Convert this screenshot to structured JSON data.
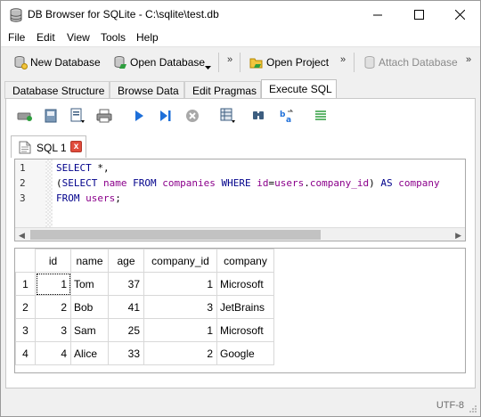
{
  "window": {
    "title": "DB Browser for SQLite - C:\\sqlite\\test.db"
  },
  "menu": [
    "File",
    "Edit",
    "View",
    "Tools",
    "Help"
  ],
  "toolbar": {
    "new_db": "New Database",
    "open_db": "Open Database",
    "more": "»",
    "open_project": "Open Project",
    "attach_db": "Attach Database"
  },
  "tabs": [
    "Database Structure",
    "Browse Data",
    "Edit Pragmas",
    "Execute SQL"
  ],
  "sql_tab": {
    "label": "SQL 1",
    "close": "x"
  },
  "editor": {
    "line_numbers": [
      "1",
      "2",
      "3"
    ],
    "lines": [
      [
        {
          "t": "SELECT",
          "c": "kw"
        },
        {
          "t": " *,",
          "c": ""
        }
      ],
      [
        {
          "t": "(",
          "c": ""
        },
        {
          "t": "SELECT",
          "c": "kw"
        },
        {
          "t": " ",
          "c": ""
        },
        {
          "t": "name",
          "c": "idt"
        },
        {
          "t": " ",
          "c": ""
        },
        {
          "t": "FROM",
          "c": "kw"
        },
        {
          "t": " ",
          "c": ""
        },
        {
          "t": "companies",
          "c": "idt"
        },
        {
          "t": " ",
          "c": ""
        },
        {
          "t": "WHERE",
          "c": "kw"
        },
        {
          "t": " ",
          "c": ""
        },
        {
          "t": "id",
          "c": "idt"
        },
        {
          "t": "=",
          "c": ""
        },
        {
          "t": "users",
          "c": "idt"
        },
        {
          "t": ".",
          "c": ""
        },
        {
          "t": "company_id",
          "c": "idt"
        },
        {
          "t": ") ",
          "c": ""
        },
        {
          "t": "AS",
          "c": "kw"
        },
        {
          "t": " ",
          "c": ""
        },
        {
          "t": "company",
          "c": "idt"
        }
      ],
      [
        {
          "t": "FROM",
          "c": "kw"
        },
        {
          "t": " ",
          "c": ""
        },
        {
          "t": "users",
          "c": "idt"
        },
        {
          "t": ";",
          "c": ""
        }
      ]
    ]
  },
  "results": {
    "columns": [
      "id",
      "name",
      "age",
      "company_id",
      "company"
    ],
    "rows": [
      {
        "rownum": "1",
        "id": "1",
        "name": "Tom",
        "age": "37",
        "company_id": "1",
        "company": "Microsoft"
      },
      {
        "rownum": "2",
        "id": "2",
        "name": "Bob",
        "age": "41",
        "company_id": "3",
        "company": "JetBrains"
      },
      {
        "rownum": "3",
        "id": "3",
        "name": "Sam",
        "age": "25",
        "company_id": "1",
        "company": "Microsoft"
      },
      {
        "rownum": "4",
        "id": "4",
        "name": "Alice",
        "age": "33",
        "company_id": "2",
        "company": "Google"
      }
    ]
  },
  "status": {
    "encoding": "UTF-8"
  },
  "colors": {
    "keyword": "#00008b",
    "identifier": "#8b008b",
    "close_tab": "#e04b3b",
    "accent_blue": "#1e6fd9"
  }
}
